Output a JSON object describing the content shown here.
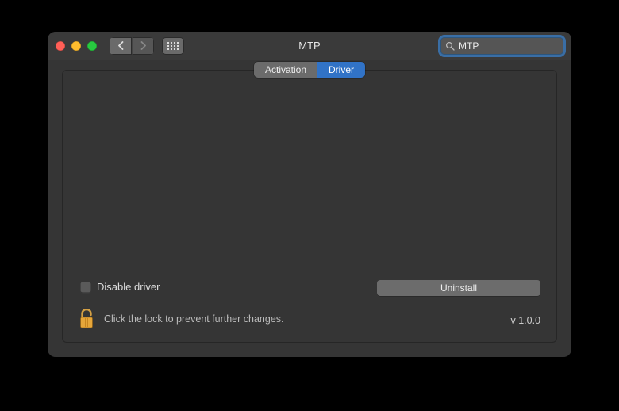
{
  "window": {
    "title": "MTP"
  },
  "search": {
    "value": "MTP"
  },
  "tabs": [
    {
      "label": "Activation",
      "active": false
    },
    {
      "label": "Driver",
      "active": true
    }
  ],
  "checkbox": {
    "label": "Disable driver",
    "checked": false
  },
  "button": {
    "uninstall": "Uninstall"
  },
  "lock": {
    "message": "Click the lock to prevent further changes."
  },
  "version": {
    "label": "v 1.0.0"
  }
}
